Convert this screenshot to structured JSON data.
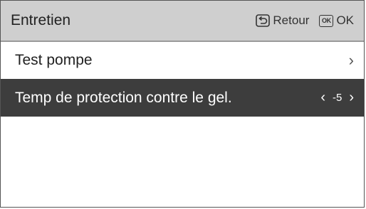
{
  "header": {
    "title": "Entretien",
    "back_label": "Retour",
    "ok_icon_text": "OK",
    "ok_label": "OK",
    "bg_color": "#cfcfcf"
  },
  "menu": {
    "items": [
      {
        "label": "Test pompe",
        "chevron": "›",
        "selected": false
      },
      {
        "label": "Temp de protection contre le gel.",
        "value": "-5",
        "left_arrow": "‹",
        "right_arrow": "›",
        "selected": true
      }
    ]
  },
  "colors": {
    "selected_row": "#3d3d3d",
    "selected_text": "#ffffff"
  }
}
